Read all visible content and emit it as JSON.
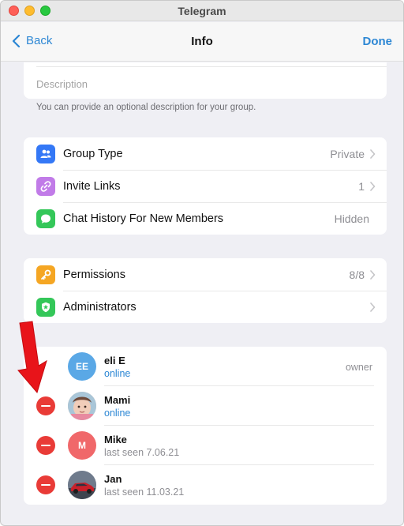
{
  "window": {
    "title": "Telegram"
  },
  "nav": {
    "back_label": "Back",
    "title": "Info",
    "done_label": "Done"
  },
  "description": {
    "placeholder": "Description",
    "hint": "You can provide an optional description for your group."
  },
  "group_settings": {
    "items": [
      {
        "label": "Group Type",
        "value": "Private",
        "icon": "people-icon",
        "color": "#3478f6"
      },
      {
        "label": "Invite Links",
        "value": "1",
        "icon": "link-icon",
        "color": "#c17be8"
      },
      {
        "label": "Chat History For New Members",
        "value": "Hidden",
        "icon": "chat-bubble-icon",
        "color": "#34c759"
      }
    ]
  },
  "admin_settings": {
    "items": [
      {
        "label": "Permissions",
        "value": "8/8",
        "icon": "key-icon",
        "color": "#f5a623"
      },
      {
        "label": "Administrators",
        "value": "",
        "icon": "shield-icon",
        "color": "#34c759"
      }
    ]
  },
  "members": [
    {
      "name": "eli E",
      "status": "online",
      "role": "owner",
      "initials": "EE",
      "avatar_color": "#5aa8e6",
      "removable": false
    },
    {
      "name": "Mami",
      "status": "online",
      "role": "",
      "initials": "",
      "avatar_color": "#d9b7a6",
      "removable": true
    },
    {
      "name": "Mike",
      "status": "last seen 7.06.21",
      "role": "",
      "initials": "M",
      "avatar_color": "#f0686a",
      "removable": true
    },
    {
      "name": "Jan",
      "status": "last seen 11.03.21",
      "role": "",
      "initials": "",
      "avatar_color": "#9aa4b3",
      "removable": true
    }
  ],
  "colors": {
    "accent": "#2d87d4",
    "remove": "#e93b37",
    "annotation_arrow": "#e8141a"
  }
}
